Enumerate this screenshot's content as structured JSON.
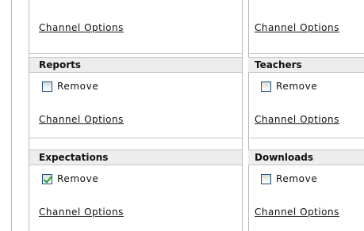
{
  "top": {
    "left_link": "Channel Options",
    "right_link": "Channel Options"
  },
  "sections": {
    "reports": {
      "title": "Reports",
      "remove_label": "Remove",
      "checked": false,
      "link": "Channel Options"
    },
    "teachers": {
      "title": "Teachers",
      "remove_label": "Remove",
      "checked": false,
      "link": "Channel Options"
    },
    "expectations": {
      "title": "Expectations",
      "remove_label": "Remove",
      "checked": true,
      "link": "Channel Options"
    },
    "downloads": {
      "title": "Downloads",
      "remove_label": "Remove",
      "checked": false,
      "link": "Channel Options"
    }
  },
  "colors": {
    "checkbox_border": "#1c5180",
    "checkmark": "#21a121",
    "header_bg": "#ededed"
  }
}
